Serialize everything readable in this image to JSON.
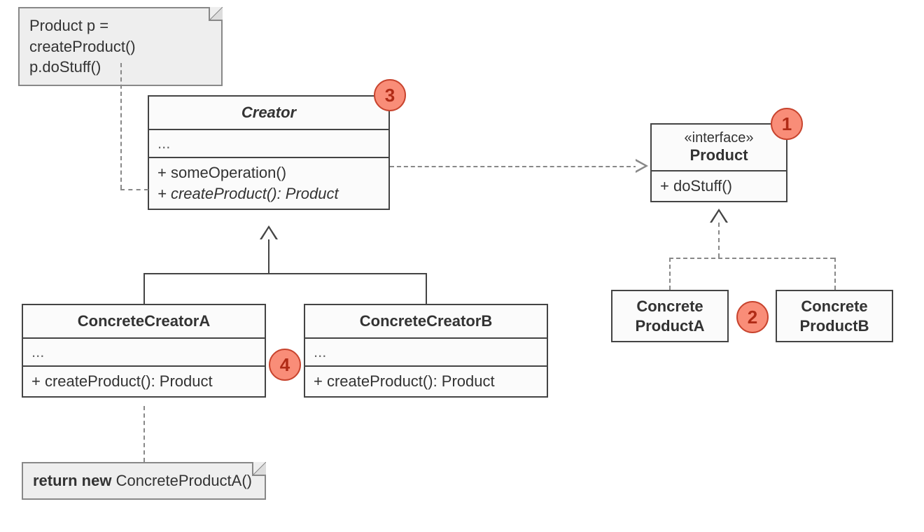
{
  "notes": {
    "someOperation": {
      "line1": "Product p = createProduct()",
      "line2": "p.doStuff()"
    },
    "concreteCreatorA": {
      "bold": "return new",
      "rest": " ConcreteProductA()"
    }
  },
  "classes": {
    "creator": {
      "name": "Creator",
      "attrs": "...",
      "op1": "+ someOperation()",
      "op2": "+ createProduct(): Product"
    },
    "concreteCreatorA": {
      "name": "ConcreteCreatorA",
      "attrs": "...",
      "op1": "+ createProduct(): Product"
    },
    "concreteCreatorB": {
      "name": "ConcreteCreatorB",
      "attrs": "...",
      "op1": "+ createProduct(): Product"
    },
    "product": {
      "stereotype": "«interface»",
      "name": "Product",
      "op1": "+ doStuff()"
    },
    "concreteProductA": {
      "line1": "Concrete",
      "line2": "ProductA"
    },
    "concreteProductB": {
      "line1": "Concrete",
      "line2": "ProductB"
    }
  },
  "badges": {
    "b1": "1",
    "b2": "2",
    "b3": "3",
    "b4": "4"
  }
}
